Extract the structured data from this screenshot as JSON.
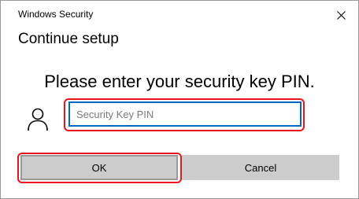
{
  "window": {
    "title": "Windows Security",
    "close_glyph": "✕"
  },
  "dialog": {
    "heading": "Continue setup",
    "prompt": "Please enter your security key PIN.",
    "pin_input": {
      "placeholder": "Security Key PIN",
      "value": ""
    },
    "ok_label": "OK",
    "cancel_label": "Cancel"
  },
  "icons": {
    "close": "close-icon",
    "user": "user-icon"
  },
  "colors": {
    "highlight": "#e8141e",
    "input_focus_border": "#0067c0",
    "button_bg": "#cccccc"
  }
}
